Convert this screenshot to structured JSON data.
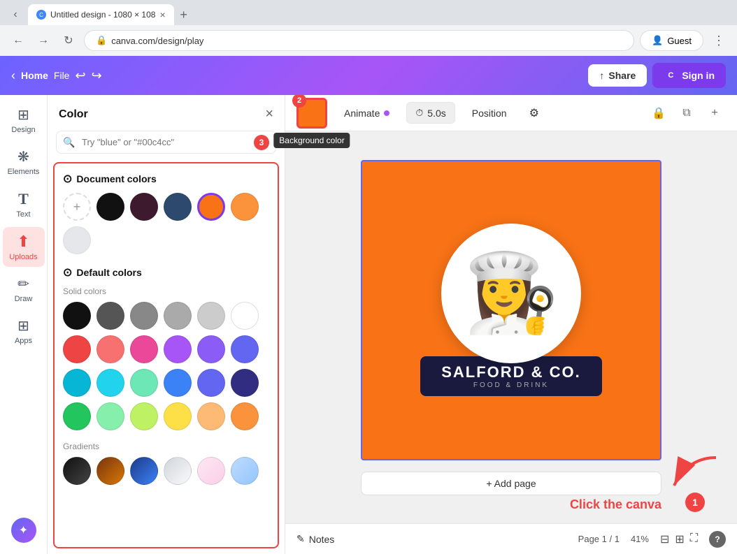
{
  "browser": {
    "tab_title": "Untitled design - 1080 × 108",
    "tab_favicon": "C",
    "url": "canva.com/design/play",
    "guest_label": "Guest",
    "menu_dots": "⋮"
  },
  "toolbar": {
    "home_label": "Home",
    "file_label": "File",
    "share_label": "Share",
    "signin_label": "Sign in",
    "undo_icon": "↩",
    "redo_icon": "↪",
    "canva_icon": "C"
  },
  "sidebar": {
    "items": [
      {
        "id": "design",
        "label": "Design",
        "icon": "⊞"
      },
      {
        "id": "elements",
        "label": "Elements",
        "icon": "⁂"
      },
      {
        "id": "text",
        "label": "Text",
        "icon": "T"
      },
      {
        "id": "uploads",
        "label": "Uploads",
        "icon": "↑"
      },
      {
        "id": "draw",
        "label": "Draw",
        "icon": "✏"
      },
      {
        "id": "apps",
        "label": "Apps",
        "icon": "⊞"
      }
    ],
    "bottom_badge": "✦"
  },
  "color_panel": {
    "title": "Color",
    "close_icon": "×",
    "search_placeholder": "Try \"blue\" or \"#00c4cc\"",
    "badge_number": "3",
    "document_colors_title": "Document colors",
    "document_colors_icon": "⊙",
    "swatches_doc": [
      {
        "color": "rainbow",
        "label": "add"
      },
      {
        "color": "#111111",
        "label": "black"
      },
      {
        "color": "#3d1a2e",
        "label": "dark-red"
      },
      {
        "color": "#2d4a6e",
        "label": "dark-blue"
      },
      {
        "color": "#f97316",
        "label": "orange-ring"
      },
      {
        "color": "#fb923c",
        "label": "orange"
      },
      {
        "color": "#e5e7eb",
        "label": "light-gray"
      }
    ],
    "default_colors_title": "Default colors",
    "default_colors_icon": "⊙",
    "solid_colors_label": "Solid colors",
    "gradients_label": "Gradients",
    "solid_colors": [
      "#111111",
      "#555555",
      "#888888",
      "#aaaaaa",
      "#cccccc",
      "#ffffff",
      "#ef4444",
      "#f87171",
      "#ec4899",
      "#a855f7",
      "#8b5cf6",
      "#6366f1",
      "#06b6d4",
      "#22d3ee",
      "#6ee7b7",
      "#3b82f6",
      "#6366f1",
      "#312e81",
      "#22c55e",
      "#86efac",
      "#bef264",
      "#fde047",
      "#fdba74",
      "#fb923c"
    ],
    "gradient_colors": [
      "#111111",
      "#78350f",
      "#1e3a8a",
      "#d1d5db",
      "#fce7f3",
      "#bfdbfe"
    ]
  },
  "canvas_toolbar": {
    "background_color_tooltip": "Background color",
    "animate_label": "Animate",
    "timer_label": "5.0s",
    "position_label": "Position",
    "more_icon": "⚙",
    "badge_number": "2",
    "lock_icon": "🔒",
    "copy_icon": "⧉",
    "plus_icon": "+"
  },
  "canvas": {
    "logo_name": "SALFORD & CO.",
    "logo_sub": "FOOD & DRINK",
    "chef_emoji": "👩‍🍳",
    "add_page_label": "+ Add page",
    "border_color": "#6366f1",
    "bg_color": "#f97316"
  },
  "annotations": {
    "badge_1": "1",
    "badge_2": "2",
    "badge_3": "3",
    "click_label": "Click the canva",
    "arrow_1": "→"
  },
  "status_bar": {
    "notes_icon": "📝",
    "notes_label": "Notes",
    "page_label": "Page 1 / 1",
    "zoom_label": "41%",
    "grid_icon": "⊞",
    "expand_icon": "⛶",
    "help_label": "?"
  }
}
